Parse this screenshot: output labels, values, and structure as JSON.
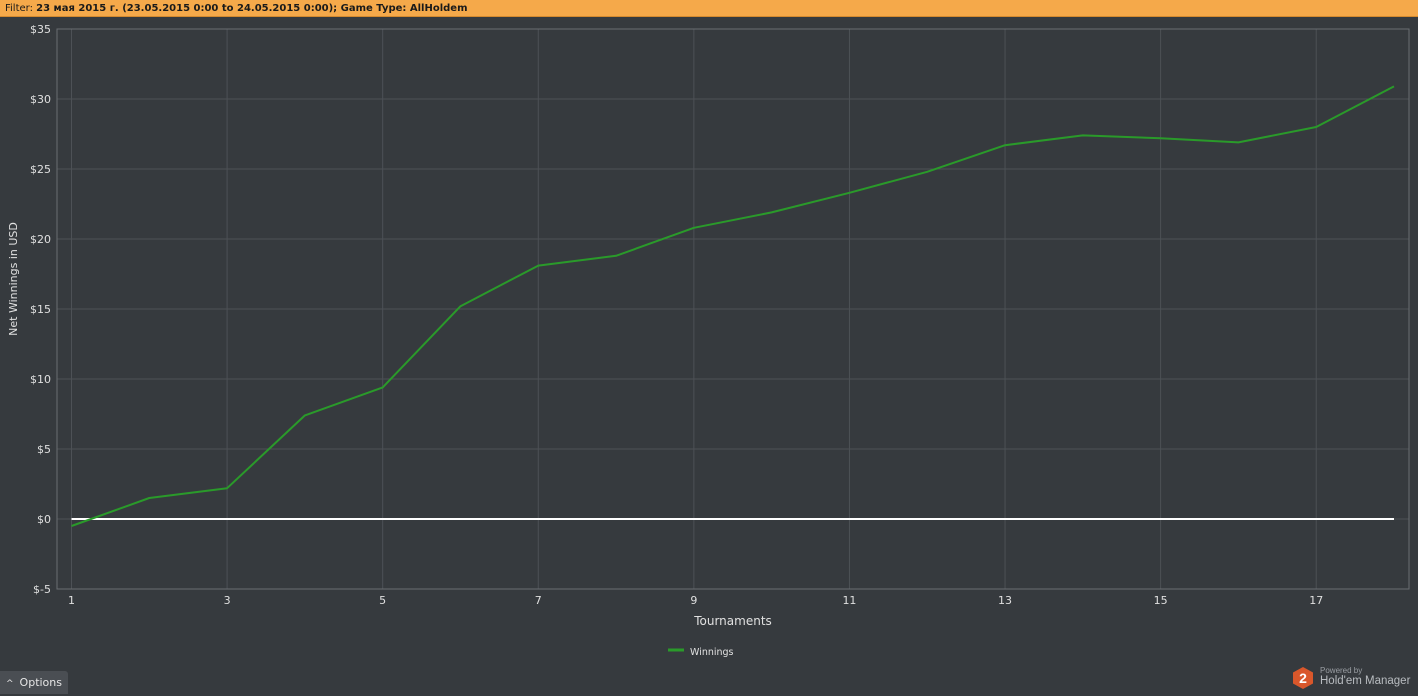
{
  "filter": {
    "label": "Filter:",
    "value": "23 мая 2015 г. (23.05.2015 0:00 to 24.05.2015 0:00); Game Type: AllHoldem"
  },
  "footer": {
    "options_label": "Options",
    "powered_by": "Powered by",
    "brand_name": "Hold'em Manager",
    "brand_badge": "2"
  },
  "colors": {
    "background": "#363a3e",
    "filter_bar": "#f5a94a",
    "series_line": "#2a9a2a",
    "zero_line": "#ffffff",
    "grid": "#4d5156",
    "brand_badge": "#d9572b"
  },
  "chart_data": {
    "type": "line",
    "xlabel": "Tournaments",
    "ylabel": "Net Winnings in USD",
    "xlim": [
      1,
      18
    ],
    "ylim": [
      -5,
      35
    ],
    "x_ticks": [
      1,
      3,
      5,
      7,
      9,
      11,
      13,
      15,
      17
    ],
    "y_ticks": [
      -5,
      0,
      5,
      10,
      15,
      20,
      25,
      30,
      35
    ],
    "y_tick_labels": [
      "$-5",
      "$0",
      "$5",
      "$10",
      "$15",
      "$20",
      "$25",
      "$30",
      "$35"
    ],
    "grid": true,
    "legend_position": "bottom",
    "zero_line": true,
    "series": [
      {
        "name": "Winnings",
        "x": [
          1,
          2,
          3,
          4,
          5,
          6,
          7,
          8,
          9,
          10,
          11,
          12,
          13,
          14,
          15,
          16,
          17,
          18
        ],
        "values": [
          -0.5,
          1.5,
          2.2,
          7.4,
          9.4,
          15.2,
          18.1,
          18.8,
          20.8,
          21.9,
          23.3,
          24.8,
          26.7,
          27.4,
          27.2,
          26.9,
          28.0,
          30.9
        ]
      }
    ]
  }
}
